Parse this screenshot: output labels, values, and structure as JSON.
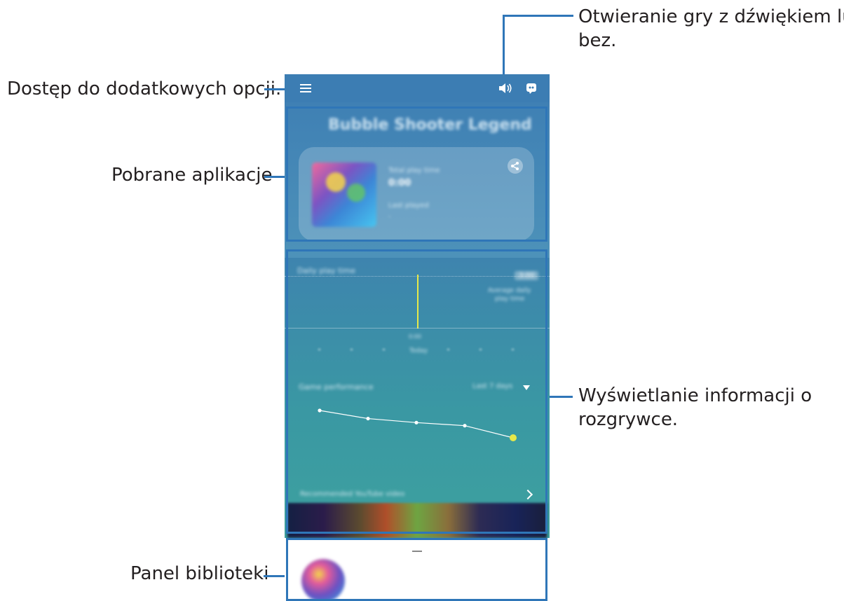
{
  "callouts": {
    "sound": {
      "line1": "Otwieranie gry z dźwiękiem lub",
      "line2": "bez."
    },
    "options": "Dostęp do dodatkowych opcji.",
    "apps": "Pobrane aplikacje",
    "info": {
      "line1": "Wyświetlanie informacji o",
      "line2": "rozgrywce."
    },
    "library": "Panel biblioteki"
  },
  "game": {
    "title": "Bubble Shooter Legend",
    "total_label": "Total play time",
    "total_value": "0:00",
    "last_label": "Last played",
    "last_value": "-"
  },
  "stats": {
    "daily_label": "Daily play time",
    "limit_badge": "3:00",
    "avg_label": "Average daily",
    "avg_value": "play time",
    "marker_label": "0:00",
    "today_label": "Today",
    "perf_label": "Game performance",
    "period": "Last 7 days",
    "youtube_label": "Recommended YouTube video"
  },
  "chart_data": {
    "type": "line",
    "title": "",
    "series": [
      {
        "values": [
          60.0,
          59.2,
          58.8,
          58.5,
          57.3
        ]
      }
    ]
  },
  "colors": {
    "accent": "#2f76b8",
    "highlight": "#e6e94a",
    "bar_top": "#3c7db3"
  }
}
